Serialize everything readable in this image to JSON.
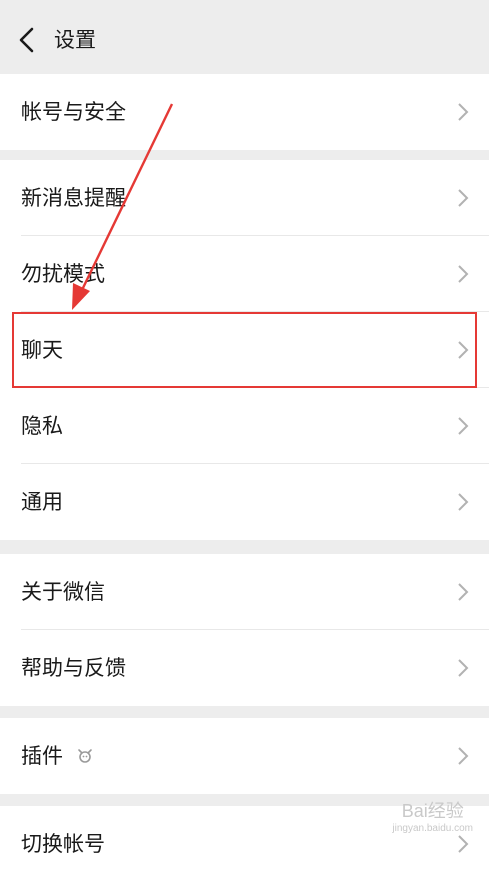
{
  "header": {
    "title": "设置",
    "back_icon": "chevron-left-icon"
  },
  "groups": [
    {
      "items": [
        {
          "label": "帐号与安全"
        }
      ]
    },
    {
      "items": [
        {
          "label": "新消息提醒"
        },
        {
          "label": "勿扰模式"
        },
        {
          "label": "聊天"
        },
        {
          "label": "隐私"
        },
        {
          "label": "通用"
        }
      ]
    },
    {
      "items": [
        {
          "label": "关于微信"
        },
        {
          "label": "帮助与反馈"
        }
      ]
    },
    {
      "items": [
        {
          "label": "插件",
          "icon": "plugin-icon"
        }
      ]
    },
    {
      "items": [
        {
          "label": "切换帐号"
        }
      ]
    }
  ],
  "annotation": {
    "highlight_color": "#e53935",
    "arrow_color": "#e53935"
  },
  "watermark": {
    "text": "Bai经验",
    "sub": "jingyan.baidu.com"
  }
}
